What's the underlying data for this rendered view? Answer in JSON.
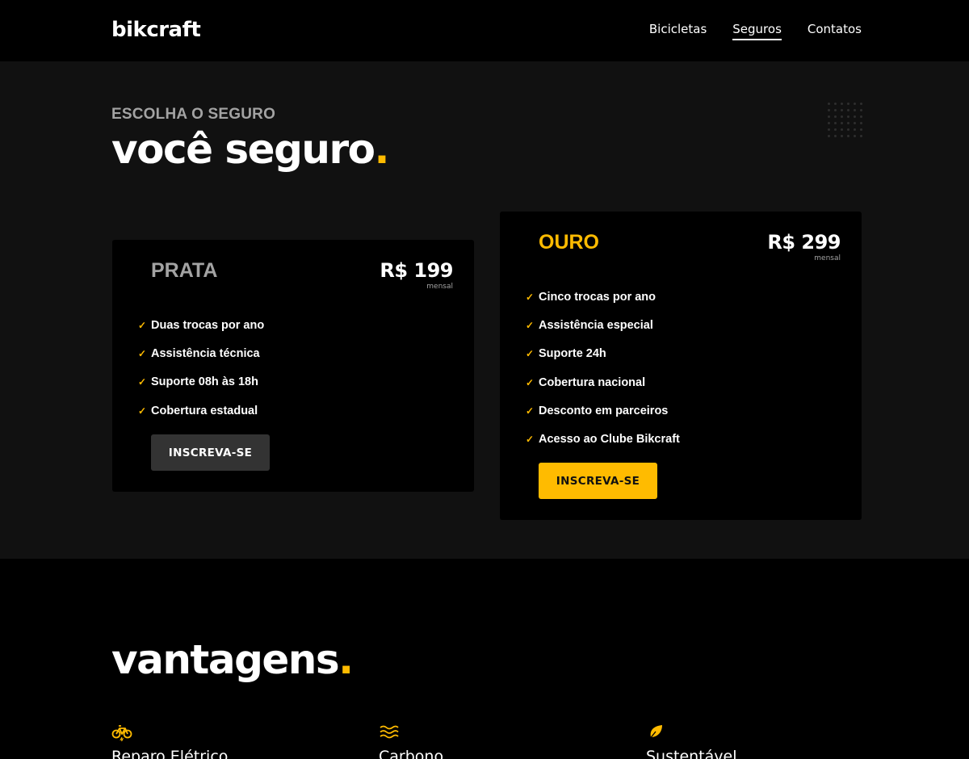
{
  "header": {
    "logo": "bikcraft",
    "nav": [
      "Bicicletas",
      "Seguros",
      "Contatos"
    ]
  },
  "seguros": {
    "subtitle": "ESCOLHA O SEGURO",
    "title": "você seguro",
    "title_dot": ".",
    "plans": [
      {
        "name": "PRATA",
        "price": "R$ 199",
        "period": "mensal",
        "features": [
          "Duas trocas por ano",
          "Assistência técnica",
          "Suporte 08h às 18h",
          "Cobertura estadual"
        ],
        "button": "INSCREVA-SE"
      },
      {
        "name": "OURO",
        "price": "R$ 299",
        "period": "mensal",
        "features": [
          "Cinco trocas por ano",
          "Assistência especial",
          "Suporte 24h",
          "Cobertura nacional",
          "Desconto em parceiros",
          "Acesso ao Clube Bikcraft"
        ],
        "button": "INSCREVA-SE"
      }
    ]
  },
  "vantagens": {
    "title": "vantagens",
    "title_dot": ".",
    "items": [
      {
        "icon": "electric-bike-icon",
        "label": "Reparo Elétrico"
      },
      {
        "icon": "waves-icon",
        "label": "Carbono"
      },
      {
        "icon": "leaf-icon",
        "label": "Sustentável"
      }
    ]
  },
  "colors": {
    "accent": "#ffbb00",
    "muted": "#a3a3a3",
    "section_bg": "#111111",
    "card_bg": "#000000"
  }
}
